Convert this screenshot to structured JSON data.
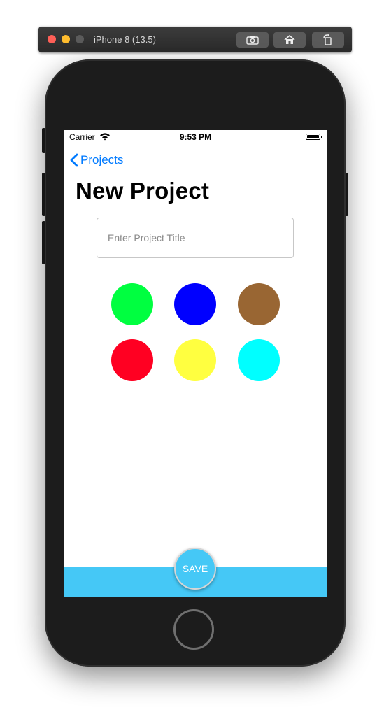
{
  "simulator": {
    "device_title": "iPhone 8 (13.5)",
    "toolbar_icons": [
      "screenshot-icon",
      "home-icon",
      "rotate-icon"
    ]
  },
  "status_bar": {
    "carrier": "Carrier",
    "time": "9:53 PM"
  },
  "nav": {
    "back_label": "Projects"
  },
  "page": {
    "title": "New Project"
  },
  "form": {
    "title_input": {
      "value": "",
      "placeholder": "Enter Project Title"
    }
  },
  "colors": {
    "swatches": [
      "#00ff40",
      "#0000ff",
      "#996633",
      "#ff0022",
      "#ffff40",
      "#00ffff"
    ],
    "accent": "#007aff",
    "save_bar": "#45c8f6"
  },
  "actions": {
    "save_label": "SAVE"
  }
}
